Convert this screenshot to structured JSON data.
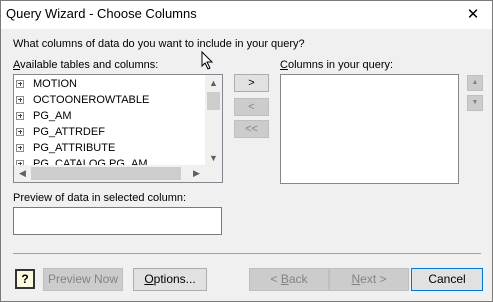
{
  "window": {
    "title": "Query Wizard - Choose Columns",
    "close_glyph": "✕"
  },
  "prompt": "What columns of data do you want to include in your query?",
  "available": {
    "label_pre": "",
    "label_acc": "A",
    "label_post": "vailable tables and columns:",
    "items": [
      "MOTION",
      "OCTOONEROWTABLE",
      "PG_AM",
      "PG_ATTRDEF",
      "PG_ATTRIBUTE",
      "PG_CATALOG.PG_AM"
    ]
  },
  "columns": {
    "label_acc": "C",
    "label_post": "olumns in your query:",
    "items": []
  },
  "transfer": {
    "add": ">",
    "remove": "<",
    "remove_all": "<<"
  },
  "preview": {
    "label": "Preview of data in selected column:",
    "value": ""
  },
  "order": {
    "up": "▲",
    "down": "▼"
  },
  "footer": {
    "help": "?",
    "preview_now": "Preview Now",
    "options_acc": "O",
    "options_post": "ptions...",
    "back_acc": "B",
    "back_post": "ack",
    "back_prefix": "< ",
    "next_acc": "N",
    "next_post": "ext >",
    "cancel": "Cancel"
  }
}
